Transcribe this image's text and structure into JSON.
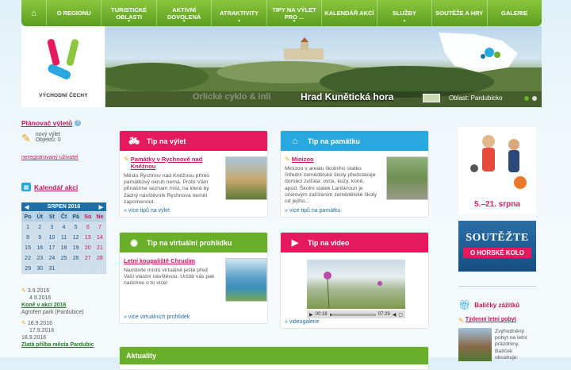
{
  "nav": {
    "home_icon": "home-icon",
    "items": [
      {
        "label": "O REGIONU"
      },
      {
        "label": "TURISTICKÉ OBLASTI"
      },
      {
        "label": "AKTIVNÍ DOVOLENÁ"
      },
      {
        "label": "ATRAKTIVITY"
      },
      {
        "label": "TIPY NA VÝLET PRO ..."
      },
      {
        "label": "KALENDÁŘ AKCÍ"
      },
      {
        "label": "SLUŽBY"
      },
      {
        "label": "SOUTĚŽE A HRY"
      },
      {
        "label": "GALERIE"
      }
    ]
  },
  "logo": {
    "text": "VÝCHODNÍ ČECHY"
  },
  "banner": {
    "title": "Hrad Kunětická hora",
    "region": "Oblast: Pardubicko",
    "faded_text": "Orlické cyklo & inli"
  },
  "planner": {
    "title": "Plánovač výletů",
    "new_trip": "nový výlet",
    "count": "Objektů: 0",
    "unregistered": "neregistrovaný uživatel"
  },
  "calendar": {
    "title": "Kalendář akcí",
    "month": "SRPEN 2016",
    "day_headers": [
      "Po",
      "Út",
      "St",
      "Čt",
      "Pá",
      "So",
      "Ne"
    ],
    "weeks": [
      [
        "1",
        "2",
        "3",
        "4",
        "5",
        "6",
        "7"
      ],
      [
        "8",
        "9",
        "10",
        "11",
        "12",
        "13",
        "14"
      ],
      [
        "15",
        "16",
        "17",
        "18",
        "19",
        "20",
        "21"
      ],
      [
        "22",
        "23",
        "24",
        "25",
        "26",
        "27",
        "28"
      ],
      [
        "29",
        "30",
        "31",
        "",
        "",
        "",
        ""
      ]
    ]
  },
  "events": [
    {
      "date": "3.9.2016",
      "date2": "4.9.2016",
      "title": "Koně v akci 2016",
      "place": "Agrofert park (Pardubice)"
    },
    {
      "date": "16.9.2016",
      "date2": "17.9.2016",
      "date3": "18.9.2016",
      "title": "Zlatá přilba města Pardubic"
    }
  ],
  "cards": {
    "trip": {
      "header": "Tip na výlet",
      "link": "Památky v Rychnově nad Kněžnou",
      "text": "Město Rychnov nad Kněžnou přímo památkový okruh nemá. Proto Vám přinášíme seznam míst, na která by žádný návštěvník Rychnova neměl zapomenout.",
      "more": "» více tipů na výlet"
    },
    "monument": {
      "header": "Tip na památku",
      "link": "Minizoo",
      "text": "Minizoo v areálu školního statku Střední zemědělské školy představuje domácí zvířata: ovce, kozy, koně, apod. Školní statek Lanškroun je účelovým zařízením zemědělské školy od jejího...",
      "more": "» více tipů na památku"
    },
    "virtual": {
      "header": "Tip na virtuální prohlídku",
      "link": "Letní koupaliště Chrudim",
      "text": "Navštivte místo virtuálně ještě před Vaší vlastní návštěvou. Určitě vás pak nadchne o to více!",
      "more": "» více virtuálních prohlídek"
    },
    "video": {
      "header": "Tip na video",
      "time_current": "00:18",
      "time_total": "07:29",
      "more": "» videogalerie"
    },
    "news": {
      "header": "Aktuality"
    }
  },
  "right": {
    "promo_date": "5.–21. srpna",
    "contest_line1": "SOUTĚŽTE",
    "contest_line2": "O HORSKÉ KOLO",
    "packages_title": "Balíčky zážitků",
    "package_link": "Týdenní letní pobyt",
    "package_text": "Zvýhodněný pobyt na letní prázdniny. Balíček obsahuje:"
  },
  "colors": {
    "nav": "#6aaf2a",
    "pink": "#e5195e",
    "blue": "#29a8e0",
    "green": "#6aaf2a",
    "calendar_blue": "#1d6fa5"
  }
}
